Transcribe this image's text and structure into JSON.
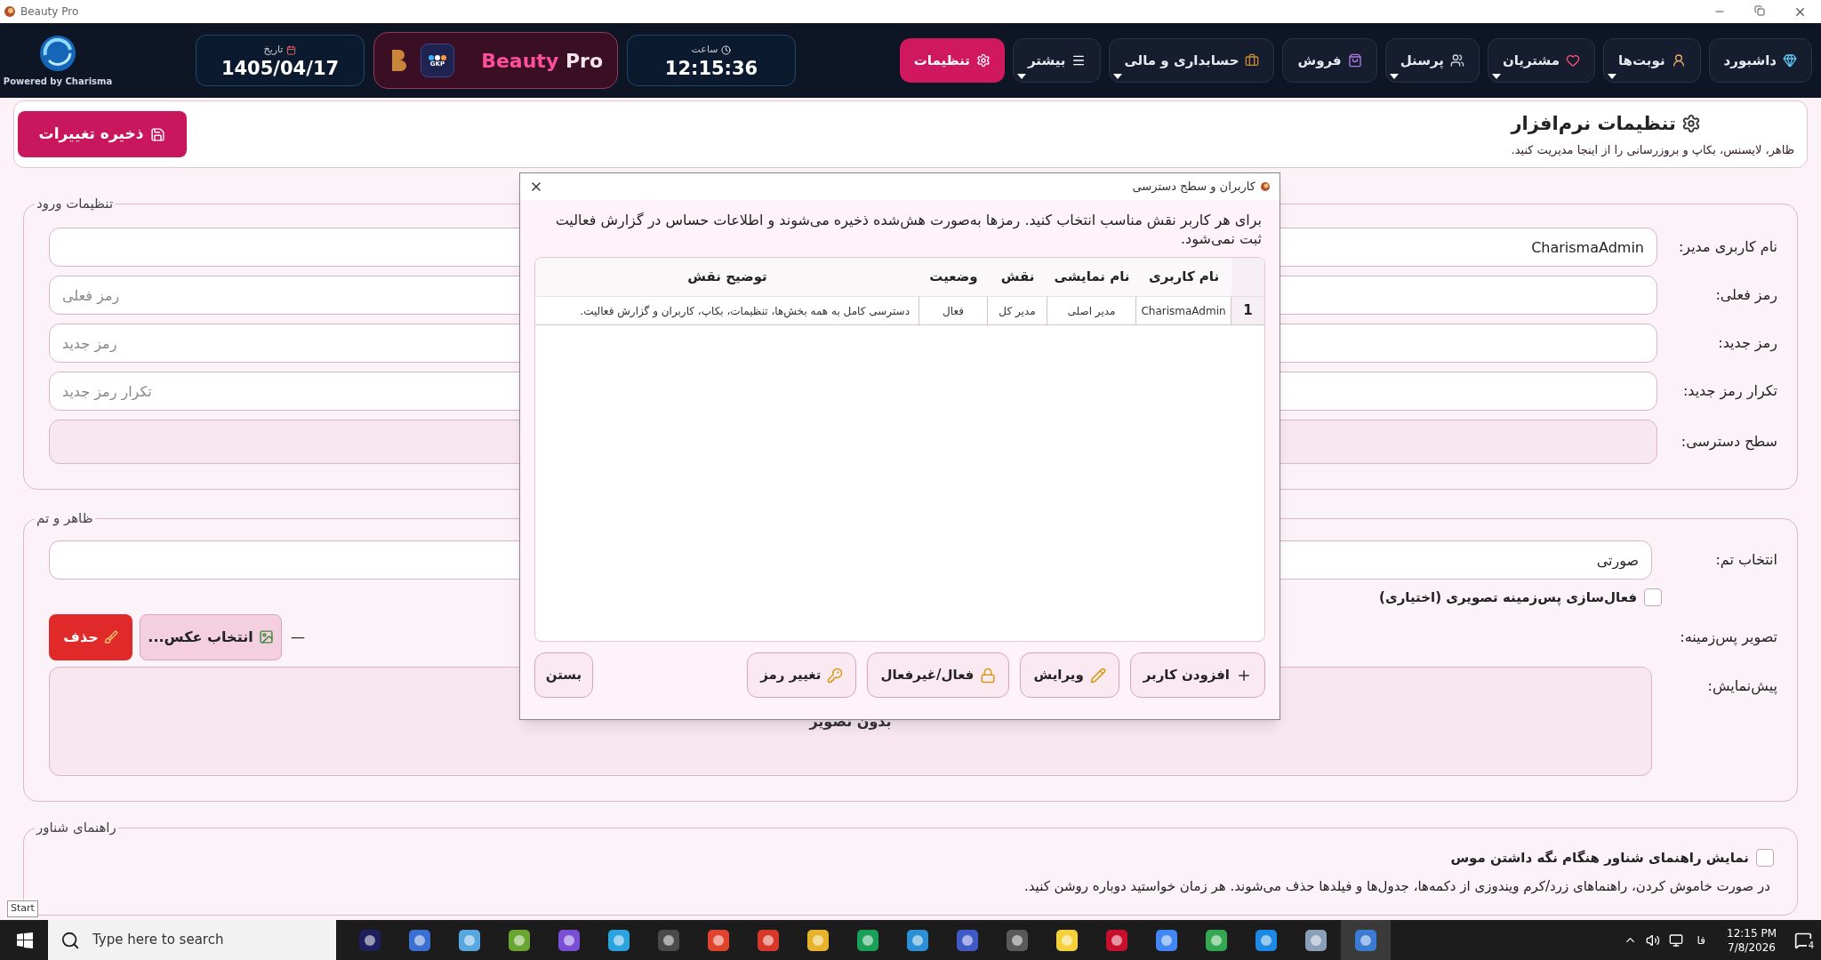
{
  "window": {
    "title": "Beauty Pro"
  },
  "top_bar": {
    "powered_by": "Powered by Charisma",
    "date": {
      "label": "تاریخ",
      "value": "1405/04/17"
    },
    "brand": {
      "badge": "GKP",
      "word1": "Beauty",
      "word2": "Pro"
    },
    "clock": {
      "label": "ساعت",
      "value": "12:15:36"
    },
    "nav": [
      {
        "label": "داشبورد",
        "has_menu": false,
        "selected": false
      },
      {
        "label": "نوبت‌ها",
        "has_menu": true,
        "selected": false
      },
      {
        "label": "مشتریان",
        "has_menu": true,
        "selected": false
      },
      {
        "label": "پرسنل",
        "has_menu": true,
        "selected": false
      },
      {
        "label": "فروش",
        "has_menu": false,
        "selected": false
      },
      {
        "label": "حسابداری و مالی",
        "has_menu": true,
        "selected": false
      },
      {
        "label": "بیشتر",
        "has_menu": true,
        "selected": false
      },
      {
        "label": "تنظیمات",
        "has_menu": false,
        "selected": true
      }
    ]
  },
  "page": {
    "title": "تنظیمات نرم‌افزار",
    "subtitle": "ظاهر، لایسنس، بکاپ و بروزرسانی را از اینجا مدیریت کنید.",
    "save_button": "ذخیره تغییرات"
  },
  "login_section": {
    "legend": "تنظیمات ورود",
    "fields": [
      {
        "kind": "text",
        "label": "نام کاربری مدیر:",
        "value": "CharismaAdmin"
      },
      {
        "kind": "text",
        "label": "رمز فعلی:",
        "placeholder": "رمز فعلی"
      },
      {
        "kind": "text",
        "label": "رمز جدید:",
        "placeholder": "رمز جدید"
      },
      {
        "kind": "text",
        "label": "تکرار رمز جدید:",
        "placeholder": "تکرار رمز جدید"
      },
      {
        "kind": "select",
        "label": "سطح دسترسی:"
      }
    ]
  },
  "appearance_section": {
    "legend": "ظاهر و تم",
    "theme": {
      "label": "انتخاب تم:",
      "value": "صورتی"
    },
    "background_toggle": {
      "label": "فعال‌سازی پس‌زمینه تصویری (اختیاری)",
      "checked": false
    },
    "background_image": {
      "label": "تصویر پس‌زمینه:",
      "path": "—",
      "choose_button": "انتخاب عکس...",
      "delete_button": "حذف"
    },
    "preview": {
      "label": "پیش‌نمایش:",
      "text": "بدون تصویر"
    }
  },
  "tooltip_section": {
    "legend": "راهنمای شناور",
    "toggle": {
      "label": "نمایش راهنمای شناور هنگام نگه داشتن موس",
      "checked": false
    },
    "note": "در صورت خاموش کردن، راهنماهای زرد/کرم ویندوزی از دکمه‌ها، جدول‌ها و فیلدها حذف می‌شوند. هر زمان خواستید دوباره روشن کنید."
  },
  "dialog": {
    "title": "کاربران و سطح دسترسی",
    "description": "برای هر کاربر نقش مناسب انتخاب کنید. رمزها به‌صورت هش‌شده ذخیره می‌شوند و اطلاعات حساس در گزارش فعالیت ثبت نمی‌شود.",
    "table": {
      "columns": [
        "نام کاربری",
        "نام نمایشی",
        "نقش",
        "وضعیت",
        "توضیح نقش"
      ],
      "rows": [
        {
          "number": "1",
          "cells": [
            "CharismaAdmin",
            "مدیر اصلی",
            "مدیر کل",
            "فعال",
            "دسترسی کامل به همه بخش‌ها، تنظیمات، بکاپ، کاربران و گزارش فعالیت."
          ]
        }
      ]
    },
    "buttons": [
      "افزودن کاربر",
      "ویرایش",
      "فعال/غیرفعال",
      "تغییر رمز"
    ],
    "close_button": "بستن"
  },
  "tooltip": {
    "text": "Start"
  },
  "taskbar": {
    "search_placeholder": "Type here to search",
    "language": "فا",
    "time": "12:15 PM",
    "date": "7/8/2026",
    "notifications": "4"
  }
}
